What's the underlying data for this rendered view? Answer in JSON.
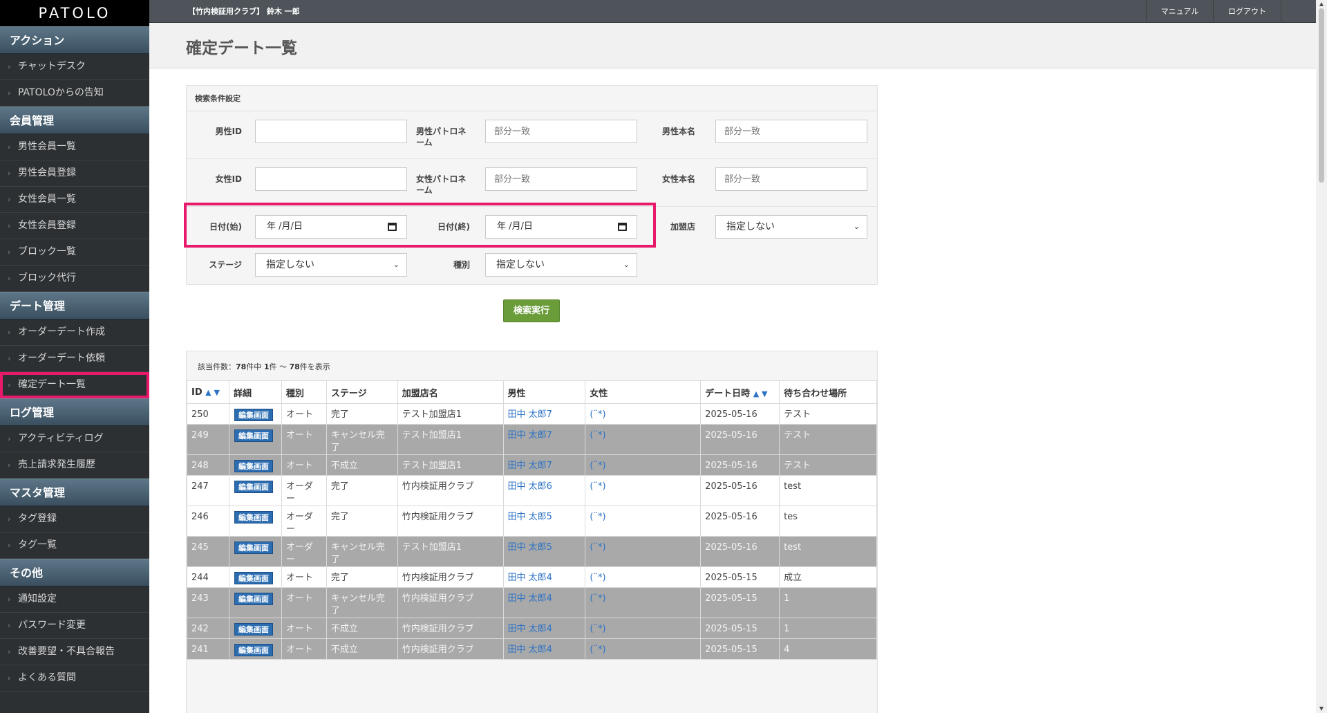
{
  "app": {
    "logo": "PATOLO"
  },
  "sidebar": {
    "sections": [
      {
        "title": "アクション",
        "items": [
          "チャットデスク",
          "PATOLOからの告知"
        ]
      },
      {
        "title": "会員管理",
        "items": [
          "男性会員一覧",
          "男性会員登録",
          "女性会員一覧",
          "女性会員登録",
          "ブロック一覧",
          "ブロック代行"
        ]
      },
      {
        "title": "デート管理",
        "items": [
          "オーダーデート作成",
          "オーダーデート依頼",
          "確定デート一覧"
        ]
      },
      {
        "title": "ログ管理",
        "items": [
          "アクティビティログ",
          "売上請求発生履歴"
        ]
      },
      {
        "title": "マスタ管理",
        "items": [
          "タグ登録",
          "タグ一覧"
        ]
      },
      {
        "title": "その他",
        "items": [
          "通知設定",
          "パスワード変更",
          "改善要望・不具合報告",
          "よくある質問"
        ]
      }
    ],
    "active_item": "確定デート一覧"
  },
  "topbar": {
    "title": "【竹内検証用クラブ】 鈴木 一郎",
    "manual": "マニュアル",
    "logout": "ログアウト"
  },
  "page": {
    "title": "確定デート一覧"
  },
  "search": {
    "header": "検索条件設定",
    "male_id_label": "男性ID",
    "male_id_value": "",
    "male_patro_label": "男性パトロネーム",
    "male_patro_placeholder": "部分一致",
    "male_name_label": "男性本名",
    "male_name_placeholder": "部分一致",
    "female_id_label": "女性ID",
    "female_id_value": "",
    "female_patro_label": "女性パトロネーム",
    "female_patro_placeholder": "部分一致",
    "female_name_label": "女性本名",
    "female_name_placeholder": "部分一致",
    "date_start_label": "日付(始)",
    "date_start_value": "年 /月/日",
    "date_end_label": "日付(終)",
    "date_end_value": "年 /月/日",
    "store_label": "加盟店",
    "store_value": "指定しない",
    "stage_label": "ステージ",
    "stage_value": "指定しない",
    "type_label": "種別",
    "type_value": "指定しない",
    "submit": "検索実行"
  },
  "results": {
    "count_prefix": "該当件数：",
    "count_total": "78",
    "count_mid1": "件中 ",
    "count_from": "1",
    "count_mid2": "件 〜 ",
    "count_to": "78",
    "count_suffix": "件を表示",
    "columns": [
      "ID",
      "詳細",
      "種別",
      "ステージ",
      "加盟店名",
      "男性",
      "女性",
      "デート日時",
      "待ち合わせ場所"
    ],
    "sort_arrows": "▲ ▼",
    "edit_label": "編集画面",
    "rows": [
      {
        "id": "250",
        "type": "オート",
        "stage": "完了",
        "store": "テスト加盟店1",
        "male": "田中 太郎7",
        "female": "(¨*)",
        "date": "2025-05-16",
        "place": "テスト",
        "shade": "white"
      },
      {
        "id": "249",
        "type": "オート",
        "stage": "キャンセル完了",
        "store": "テスト加盟店1",
        "male": "田中 太郎7",
        "female": "(¨*)",
        "date": "2025-05-16",
        "place": "テスト",
        "shade": "grey"
      },
      {
        "id": "248",
        "type": "オート",
        "stage": "不成立",
        "store": "テスト加盟店1",
        "male": "田中 太郎7",
        "female": "(¨*)",
        "date": "2025-05-16",
        "place": "テスト",
        "shade": "grey"
      },
      {
        "id": "247",
        "type": "オーダー",
        "stage": "完了",
        "store": "竹内検証用クラブ",
        "male": "田中 太郎6",
        "female": "(¨*)",
        "date": "2025-05-16",
        "place": "test",
        "shade": "white"
      },
      {
        "id": "246",
        "type": "オーダー",
        "stage": "完了",
        "store": "竹内検証用クラブ",
        "male": "田中 太郎5",
        "female": "(¨*)",
        "date": "2025-05-16",
        "place": "tes",
        "shade": "white"
      },
      {
        "id": "245",
        "type": "オーダー",
        "stage": "キャンセル完了",
        "store": "テスト加盟店1",
        "male": "田中 太郎5",
        "female": "(¨*)",
        "date": "2025-05-16",
        "place": "test",
        "shade": "grey"
      },
      {
        "id": "244",
        "type": "オート",
        "stage": "完了",
        "store": "竹内検証用クラブ",
        "male": "田中 太郎4",
        "female": "(¨*)",
        "date": "2025-05-15",
        "place": "成立",
        "shade": "white"
      },
      {
        "id": "243",
        "type": "オート",
        "stage": "キャンセル完了",
        "store": "竹内検証用クラブ",
        "male": "田中 太郎4",
        "female": "(¨*)",
        "date": "2025-05-15",
        "place": "1",
        "shade": "grey"
      },
      {
        "id": "242",
        "type": "オート",
        "stage": "不成立",
        "store": "竹内検証用クラブ",
        "male": "田中 太郎4",
        "female": "(¨*)",
        "date": "2025-05-15",
        "place": "1",
        "shade": "grey"
      },
      {
        "id": "241",
        "type": "オート",
        "stage": "不成立",
        "store": "竹内検証用クラブ",
        "male": "田中 太郎4",
        "female": "(¨*)",
        "date": "2025-05-15",
        "place": "4",
        "shade": "grey"
      }
    ]
  },
  "colors": {
    "highlight": "#e8196a",
    "link": "#2d73c4",
    "submit": "#6a9c3a"
  }
}
